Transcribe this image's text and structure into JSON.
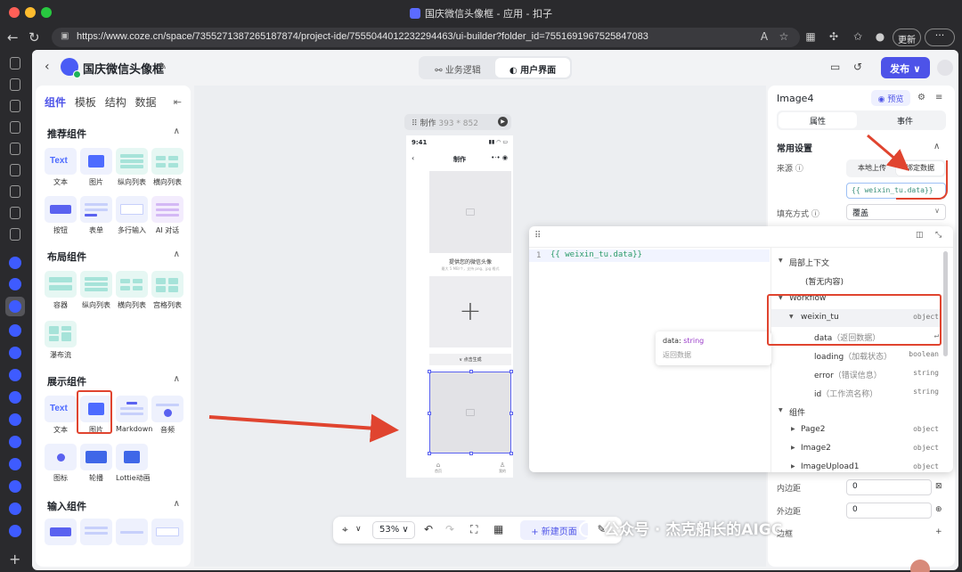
{
  "window": {
    "title": "国庆微信头像框 - 应用 - 扣子",
    "url": "https://www.coze.cn/space/7355271387265187874/project-ide/7555044012232294463/ui-builder?folder_id=7551691967525847083",
    "update_label": "更新",
    "more_label": "···"
  },
  "app": {
    "name": "国庆微信头像框",
    "modes": [
      {
        "label": "业务逻辑",
        "active": false
      },
      {
        "label": "用户界面",
        "active": true
      }
    ],
    "publish_label": "发布"
  },
  "components_panel": {
    "tabs": [
      "组件",
      "模板",
      "结构",
      "数据"
    ],
    "sections": [
      {
        "title": "推荐组件",
        "items": [
          "文本",
          "图片",
          "纵向列表",
          "横向列表",
          "按钮",
          "表单",
          "多行输入",
          "AI 对话"
        ]
      },
      {
        "title": "布局组件",
        "items": [
          "容器",
          "纵向列表",
          "横向列表",
          "宫格列表",
          "瀑布流"
        ]
      },
      {
        "title": "展示组件",
        "items": [
          "文本",
          "图片",
          "Markdown",
          "音频",
          "图标",
          "轮播",
          "Lottie动画"
        ]
      },
      {
        "title": "输入组件",
        "items": []
      }
    ],
    "thumb_text": "Text",
    "thumb_button": "Button"
  },
  "canvas": {
    "frame_label": "制作",
    "frame_size": "393 * 852",
    "phone": {
      "time": "9:41",
      "nav_title": "制作",
      "caption": "提供您的微信头像",
      "subcaption": "最大 5 MB/个，支持 png、jpg 格式",
      "generate_label": "∨ 点击生成",
      "tabs": [
        "首页",
        "我的"
      ]
    },
    "zoom": "53%",
    "new_page_label": "新建页面"
  },
  "properties": {
    "component_name": "Image4",
    "preview_label": "预览",
    "tabs": [
      {
        "label": "属性",
        "active": true
      },
      {
        "label": "事件",
        "active": false
      }
    ],
    "section": "常用设置",
    "source_label": "来源",
    "source_options": [
      {
        "label": "本地上传",
        "active": false
      },
      {
        "label": "绑定数据",
        "active": true
      }
    ],
    "bound_value": "{{ weixin_tu.data}}",
    "fill_label": "填充方式",
    "fill_value": "覆盖",
    "padding_label": "内边距",
    "padding_value": "0",
    "margin_label": "外边距",
    "margin_value": "0",
    "extra_label": "边框"
  },
  "binding_editor": {
    "line_number": "1",
    "code": "{{ weixin_tu.data}}",
    "tree": [
      {
        "name": "局部上下文",
        "hint": "",
        "type": "",
        "level": 0,
        "expanded": true
      },
      {
        "name": "(暂无内容)",
        "hint": "",
        "type": "",
        "level": 2,
        "expanded": null
      },
      {
        "name": "Workflow",
        "hint": "",
        "type": "",
        "level": 0,
        "expanded": true
      },
      {
        "name": "weixin_tu",
        "hint": "",
        "type": "object",
        "level": 1,
        "expanded": true
      },
      {
        "name": "data",
        "hint": "（返回数据）",
        "type": "↵",
        "level": 2,
        "expanded": null
      },
      {
        "name": "loading",
        "hint": "（加载状态）",
        "type": "boolean",
        "level": 2,
        "expanded": null
      },
      {
        "name": "error",
        "hint": "（错误信息）",
        "type": "string",
        "level": 2,
        "expanded": null
      },
      {
        "name": "id",
        "hint": "（工作流名称）",
        "type": "string",
        "level": 2,
        "expanded": null
      },
      {
        "name": "组件",
        "hint": "",
        "type": "",
        "level": 0,
        "expanded": true
      },
      {
        "name": "Page2",
        "hint": "",
        "type": "object",
        "level": 1,
        "expanded": false
      },
      {
        "name": "Image2",
        "hint": "",
        "type": "object",
        "level": 1,
        "expanded": false
      },
      {
        "name": "ImageUpload1",
        "hint": "",
        "type": "object",
        "level": 1,
        "expanded": false
      }
    ],
    "tooltip": {
      "key": "data:",
      "type": "string",
      "desc": "返回数据"
    }
  },
  "watermark": "公众号 · 杰克船长的AIGC",
  "colors": {
    "accent": "#4d53e8",
    "annotation": "#e0442f",
    "code": "#2c9b6a"
  }
}
